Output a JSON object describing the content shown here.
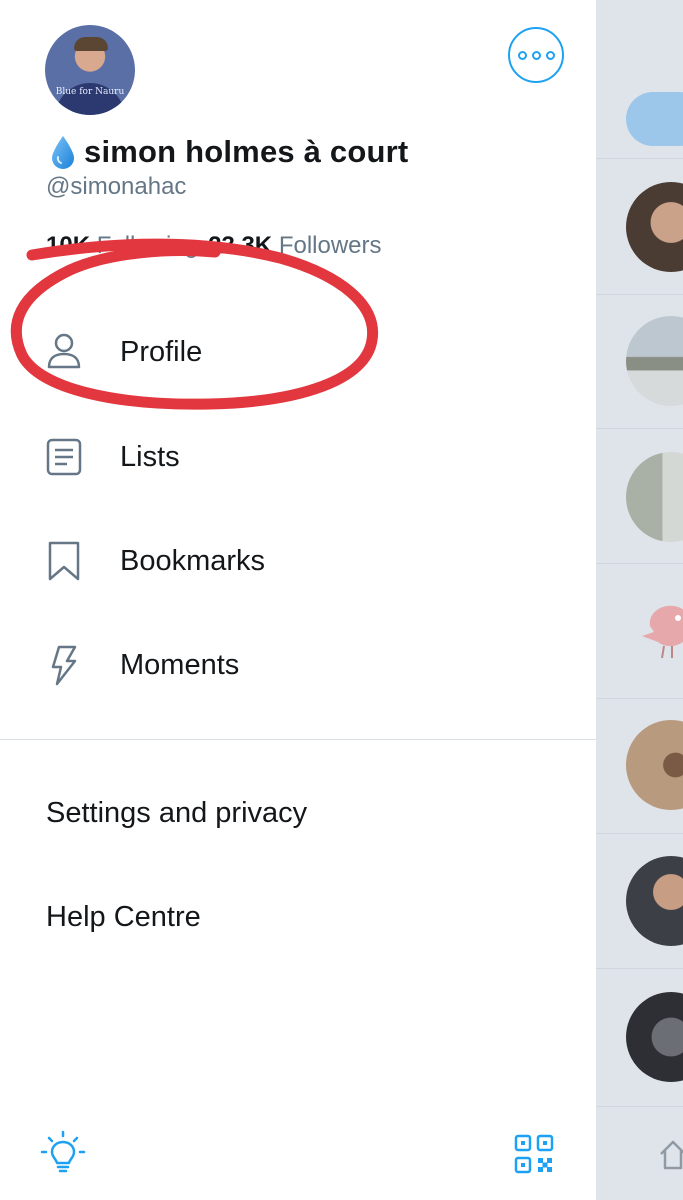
{
  "user": {
    "display_name": "simon holmes à court",
    "handle": "@simonahac",
    "avatar_caption": "Blue for Nauru",
    "following_count": "10K",
    "following_label": "Following",
    "followers_count": "23.3K",
    "followers_label": "Followers"
  },
  "menu": {
    "items": [
      {
        "label": "Profile",
        "icon": "person-icon"
      },
      {
        "label": "Lists",
        "icon": "list-icon"
      },
      {
        "label": "Bookmarks",
        "icon": "bookmark-icon"
      },
      {
        "label": "Moments",
        "icon": "lightning-icon"
      }
    ],
    "secondary": [
      {
        "label": "Settings and privacy"
      },
      {
        "label": "Help Centre"
      }
    ]
  },
  "footer": {
    "left_icon": "lightbulb-icon",
    "right_icon": "qr-code-icon"
  },
  "colors": {
    "accent": "#1da1f2",
    "annotation": "#e2373f",
    "secondary_text": "#657786",
    "primary_text": "#14171a"
  }
}
